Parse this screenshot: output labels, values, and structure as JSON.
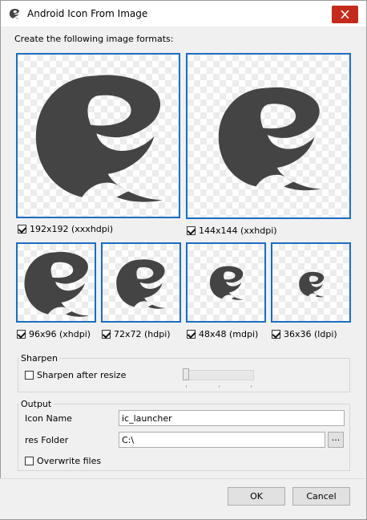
{
  "window": {
    "title": "Android Icon From Image",
    "close_icon": "close-icon"
  },
  "formats": {
    "heading": "Create the following image formats:",
    "items": [
      {
        "label": "192x192 (xxxhdpi)",
        "checked": true
      },
      {
        "label": "144x144 (xxhdpi)",
        "checked": true
      },
      {
        "label": "96x96 (xhdpi)",
        "checked": true
      },
      {
        "label": "72x72 (hdpi)",
        "checked": true
      },
      {
        "label": "48x48 (mdpi)",
        "checked": true
      },
      {
        "label": "36x36 (ldpi)",
        "checked": true
      }
    ]
  },
  "sharpen": {
    "group_label": "Sharpen",
    "checkbox_label": "Sharpen after resize",
    "checked": false,
    "level": 0
  },
  "output": {
    "group_label": "Output",
    "icon_name_label": "Icon Name",
    "icon_name_value": "ic_launcher",
    "res_folder_label": "res Folder",
    "res_folder_value": "C:\\",
    "browse_label": "...",
    "overwrite_label": "Overwrite files",
    "overwrite_checked": false
  },
  "buttons": {
    "ok": "OK",
    "cancel": "Cancel"
  },
  "colors": {
    "selection_border": "#1b6ec2",
    "close_button": "#c42b1c",
    "logo_fill": "#444444"
  }
}
